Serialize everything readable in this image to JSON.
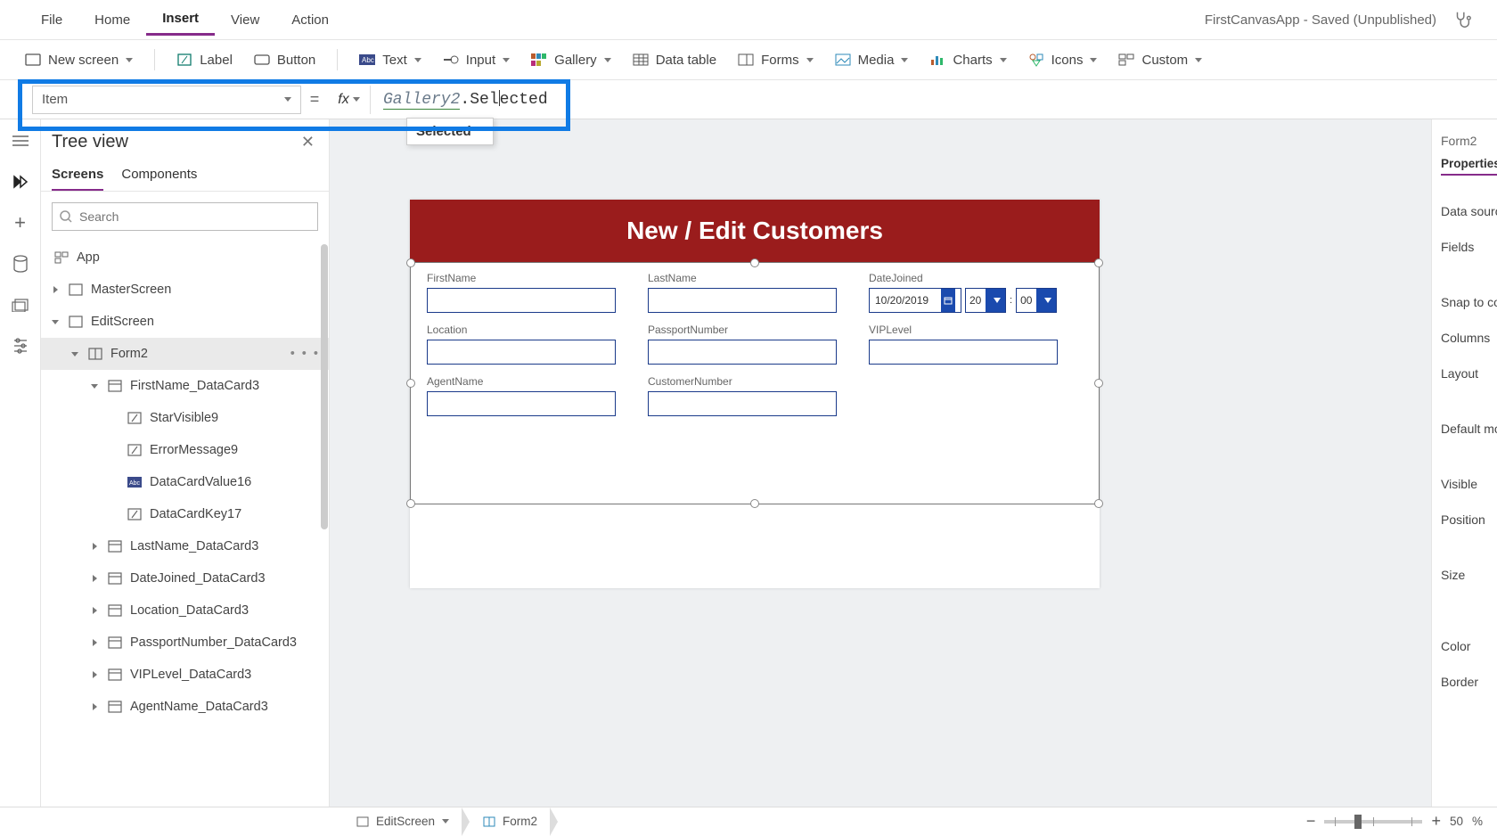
{
  "menu": {
    "items": [
      "File",
      "Home",
      "Insert",
      "View",
      "Action"
    ],
    "active_index": 2,
    "app_title": "FirstCanvasApp - Saved (Unpublished)"
  },
  "ribbon": {
    "items": [
      {
        "label": "New screen",
        "icon": "screen-add",
        "dd": true
      },
      {
        "label": "Label",
        "icon": "label",
        "dd": false
      },
      {
        "label": "Button",
        "icon": "button",
        "dd": false
      },
      {
        "label": "Text",
        "icon": "text",
        "dd": true
      },
      {
        "label": "Input",
        "icon": "input",
        "dd": true
      },
      {
        "label": "Gallery",
        "icon": "gallery",
        "dd": true
      },
      {
        "label": "Data table",
        "icon": "datatable",
        "dd": false
      },
      {
        "label": "Forms",
        "icon": "forms",
        "dd": true
      },
      {
        "label": "Media",
        "icon": "media",
        "dd": true
      },
      {
        "label": "Charts",
        "icon": "charts",
        "dd": true
      },
      {
        "label": "Icons",
        "icon": "icons",
        "dd": true
      },
      {
        "label": "Custom",
        "icon": "custom",
        "dd": true
      }
    ]
  },
  "formula_bar": {
    "property": "Item",
    "gallery_ref": "Gallery2",
    "suffix": ".Selected",
    "suggestion": "Selected"
  },
  "tree_view": {
    "title": "Tree view",
    "tabs": [
      "Screens",
      "Components"
    ],
    "search_placeholder": "Search",
    "app_label": "App",
    "items": [
      {
        "label": "MasterScreen",
        "indent": 0,
        "icon": "screen",
        "chev": "right"
      },
      {
        "label": "EditScreen",
        "indent": 0,
        "icon": "screen",
        "chev": "down"
      },
      {
        "label": "Form2",
        "indent": 1,
        "icon": "form",
        "chev": "down",
        "selected": true,
        "more": true
      },
      {
        "label": "FirstName_DataCard3",
        "indent": 2,
        "icon": "card",
        "chev": "down"
      },
      {
        "label": "StarVisible9",
        "indent": 3,
        "icon": "label2",
        "chev": ""
      },
      {
        "label": "ErrorMessage9",
        "indent": 3,
        "icon": "label2",
        "chev": ""
      },
      {
        "label": "DataCardValue16",
        "indent": 3,
        "icon": "textinput",
        "chev": ""
      },
      {
        "label": "DataCardKey17",
        "indent": 3,
        "icon": "label2",
        "chev": ""
      },
      {
        "label": "LastName_DataCard3",
        "indent": 2,
        "icon": "card",
        "chev": "right"
      },
      {
        "label": "DateJoined_DataCard3",
        "indent": 2,
        "icon": "card",
        "chev": "right"
      },
      {
        "label": "Location_DataCard3",
        "indent": 2,
        "icon": "card",
        "chev": "right"
      },
      {
        "label": "PassportNumber_DataCard3",
        "indent": 2,
        "icon": "card",
        "chev": "right"
      },
      {
        "label": "VIPLevel_DataCard3",
        "indent": 2,
        "icon": "card",
        "chev": "right"
      },
      {
        "label": "AgentName_DataCard3",
        "indent": 2,
        "icon": "card",
        "chev": "right"
      }
    ]
  },
  "canvas": {
    "header_title": "New / Edit Customers",
    "rows": [
      [
        {
          "label": "FirstName",
          "type": "text"
        },
        {
          "label": "LastName",
          "type": "text"
        },
        {
          "label": "DateJoined",
          "type": "date",
          "value": "10/20/2019",
          "hh": "20",
          "mm": "00"
        }
      ],
      [
        {
          "label": "Location",
          "type": "text"
        },
        {
          "label": "PassportNumber",
          "type": "text"
        },
        {
          "label": "VIPLevel",
          "type": "text"
        }
      ],
      [
        {
          "label": "AgentName",
          "type": "text"
        },
        {
          "label": "CustomerNumber",
          "type": "text"
        }
      ]
    ]
  },
  "properties": {
    "title": "Form2",
    "tab": "Properties",
    "rows": [
      "Data source",
      "Fields",
      "Snap to colu",
      "Columns",
      "Layout",
      "Default mod",
      "Visible",
      "Position",
      "Size",
      "Color",
      "Border"
    ]
  },
  "status_bar": {
    "crumbs": [
      "EditScreen",
      "Form2"
    ],
    "zoom_value": "50",
    "zoom_suffix": "%"
  }
}
